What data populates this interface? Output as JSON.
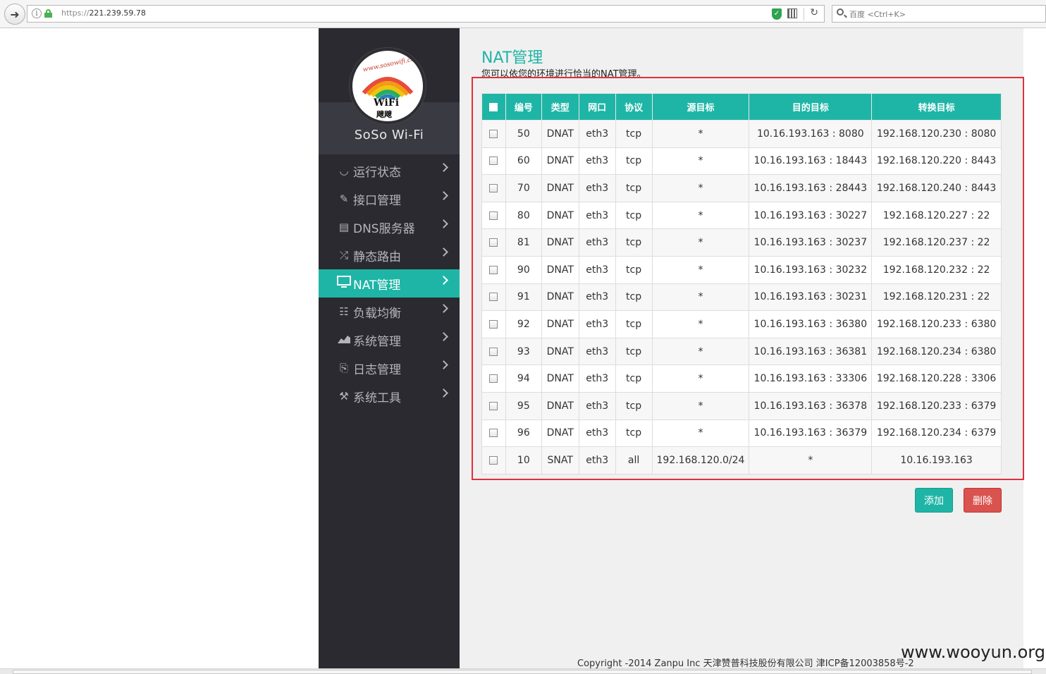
{
  "browser": {
    "url_scheme": "https://",
    "url_host": "221.239.59.78",
    "search_placeholder": "百度 <Ctrl+K>"
  },
  "sidebar": {
    "brand_name": "SoSo Wi-Fi",
    "logo_url_text": "www.sosowifi.com",
    "logo_wifi_text": "WiFi",
    "logo_cn_text": "飕飕",
    "items": [
      {
        "label": "运行状态",
        "icon": "dashboard-icon",
        "active": false
      },
      {
        "label": "接口管理",
        "icon": "pencil-icon",
        "active": false
      },
      {
        "label": "DNS服务器",
        "icon": "server-icon",
        "active": false
      },
      {
        "label": "静态路由",
        "icon": "shuffle-icon",
        "active": false
      },
      {
        "label": "NAT管理",
        "icon": "monitor-icon",
        "active": true
      },
      {
        "label": "负载均衡",
        "icon": "sliders-icon",
        "active": false
      },
      {
        "label": "系统管理",
        "icon": "area-chart-icon",
        "active": false
      },
      {
        "label": "日志管理",
        "icon": "log-icon",
        "active": false
      },
      {
        "label": "系统工具",
        "icon": "tools-icon",
        "active": false
      }
    ]
  },
  "main": {
    "title": "NAT管理",
    "subtitle": "您可以依您的环境进行恰当的NAT管理。",
    "columns": [
      "编号",
      "类型",
      "网口",
      "协议",
      "源目标",
      "目的目标",
      "转换目标"
    ],
    "rows": [
      [
        "50",
        "DNAT",
        "eth3",
        "tcp",
        "*",
        "10.16.193.163 : 8080",
        "192.168.120.230 : 8080"
      ],
      [
        "60",
        "DNAT",
        "eth3",
        "tcp",
        "*",
        "10.16.193.163 : 18443",
        "192.168.120.220 : 8443"
      ],
      [
        "70",
        "DNAT",
        "eth3",
        "tcp",
        "*",
        "10.16.193.163 : 28443",
        "192.168.120.240 : 8443"
      ],
      [
        "80",
        "DNAT",
        "eth3",
        "tcp",
        "*",
        "10.16.193.163 : 30227",
        "192.168.120.227 : 22"
      ],
      [
        "81",
        "DNAT",
        "eth3",
        "tcp",
        "*",
        "10.16.193.163 : 30237",
        "192.168.120.237 : 22"
      ],
      [
        "90",
        "DNAT",
        "eth3",
        "tcp",
        "*",
        "10.16.193.163 : 30232",
        "192.168.120.232 : 22"
      ],
      [
        "91",
        "DNAT",
        "eth3",
        "tcp",
        "*",
        "10.16.193.163 : 30231",
        "192.168.120.231 : 22"
      ],
      [
        "92",
        "DNAT",
        "eth3",
        "tcp",
        "*",
        "10.16.193.163 : 36380",
        "192.168.120.233 : 6380"
      ],
      [
        "93",
        "DNAT",
        "eth3",
        "tcp",
        "*",
        "10.16.193.163 : 36381",
        "192.168.120.234 : 6380"
      ],
      [
        "94",
        "DNAT",
        "eth3",
        "tcp",
        "*",
        "10.16.193.163 : 33306",
        "192.168.120.228 : 3306"
      ],
      [
        "95",
        "DNAT",
        "eth3",
        "tcp",
        "*",
        "10.16.193.163 : 36378",
        "192.168.120.233 : 6379"
      ],
      [
        "96",
        "DNAT",
        "eth3",
        "tcp",
        "*",
        "10.16.193.163 : 36379",
        "192.168.120.234 : 6379"
      ],
      [
        "10",
        "SNAT",
        "eth3",
        "all",
        "192.168.120.0/24",
        "*",
        "10.16.193.163"
      ]
    ],
    "add_label": "添加",
    "delete_label": "删除"
  },
  "footer": {
    "copyright": "Copyright -2014 Zanpu Inc 天津赞普科技股份有限公司 津ICP备12003858号-2"
  },
  "watermark": "www.wooyun.org",
  "colors": {
    "accent": "#1fb5a6",
    "sidebar_bg": "#2a2a30",
    "delete": "#d9534f",
    "highlight_border": "#e0303a"
  }
}
